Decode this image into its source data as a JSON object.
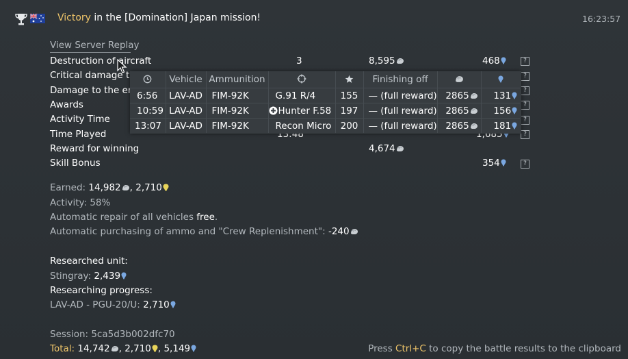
{
  "header": {
    "victory": "Victory",
    "message": " in the [Domination] Japan mission!",
    "time": "16:23:57",
    "icons": [
      "trophy-icon",
      "australia-flag-icon"
    ]
  },
  "replay_link": "View Server Replay",
  "rewards": [
    {
      "label": "Destruction of aircraft",
      "count": "3",
      "lions": "8,595",
      "rp": "468"
    },
    {
      "label": "Critical damage to",
      "rp": ""
    },
    {
      "label": "Damage to the ene",
      "rp": ""
    },
    {
      "label": "Awards",
      "rp": ""
    },
    {
      "label": "Activity Time",
      "rp": ""
    },
    {
      "label": "Time Played",
      "count": "13:48",
      "rp": "1,685"
    },
    {
      "label": "Reward for winning",
      "lions": "4,674"
    },
    {
      "label": "Skill Bonus",
      "rp": "354"
    }
  ],
  "popup": {
    "headers": [
      "Vehicle",
      "Ammunition",
      "Finishing off"
    ],
    "header_icons": [
      "clock-icon",
      "crosshair-icon",
      "star-icon",
      "lion-icon",
      "rp-icon"
    ],
    "rows": [
      {
        "time": "6:56",
        "vehicle": "LAV-AD",
        "ammo": "FIM-92K",
        "target": "G.91 R/4",
        "score": "155",
        "finish": "— (full reward)",
        "lions": "2865",
        "rp": "131"
      },
      {
        "time": "10:59",
        "vehicle": "LAV-AD",
        "ammo": "FIM-92K",
        "target": "Hunter F.58",
        "score": "197",
        "finish": "— (full reward)",
        "lions": "2865",
        "rp": "156"
      },
      {
        "time": "13:07",
        "vehicle": "LAV-AD",
        "ammo": "FIM-92K",
        "target": "Recon Micro",
        "score": "200",
        "finish": "— (full reward)",
        "lions": "2865",
        "rp": "181"
      }
    ]
  },
  "summary": {
    "earned_label": "Earned: ",
    "earned_lions": "14,982",
    "earned_sep": ", ",
    "earned_gold": "2,710",
    "activity": "Activity: 58%",
    "repair_prefix": "Automatic repair of all vehicles ",
    "repair_value": "free",
    "repair_suffix": ".",
    "ammo_text": "Automatic purchasing of ammo and \"Crew Replenishment\": ",
    "ammo_value": "-240"
  },
  "research": {
    "unit_label": "Researched unit:",
    "unit_name": "Stingray: ",
    "unit_rp": "2,439",
    "progress_label": "Researching progress:",
    "progress_name": "LAV-AD - PGU-20/U: ",
    "progress_rp": "2,710"
  },
  "session": {
    "label": "Session: 5ca5d3b002dfc70",
    "total_label": "Total: ",
    "total_lions": "14,742",
    "total_gold": "2,710",
    "total_rp": "5,149",
    "sep": ", "
  },
  "footer": {
    "prefix": "Press ",
    "shortcut": "Ctrl+C",
    "suffix": " to copy the battle results to the clipboard"
  },
  "help_glyph": "?",
  "colors": {
    "background": "#2b3034",
    "accent_gold": "#f0c66a",
    "rp_blue": "#7aa7e0",
    "muted": "#b2b8bd"
  }
}
